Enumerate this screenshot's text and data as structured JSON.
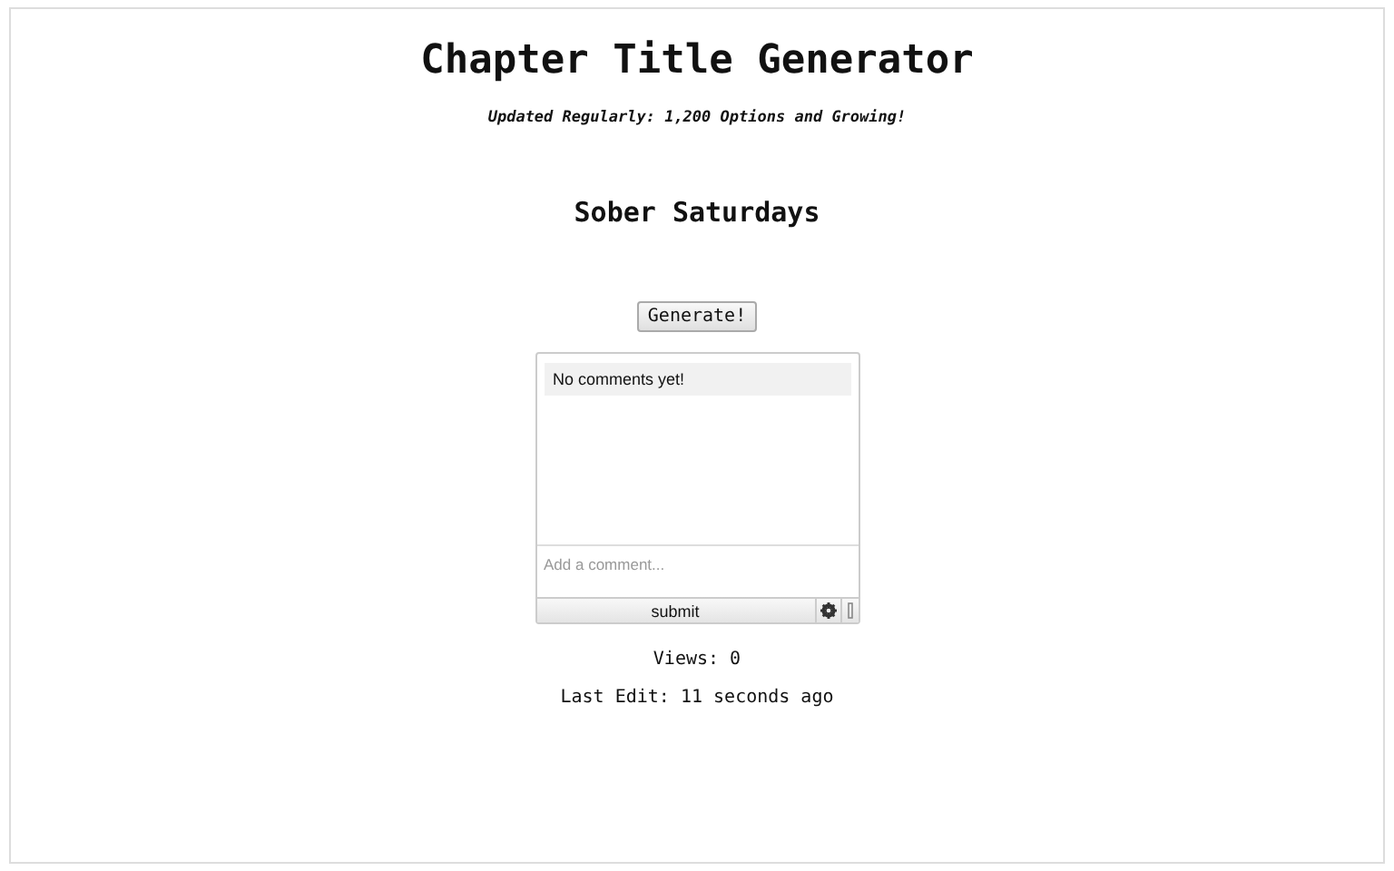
{
  "title": "Chapter Title Generator",
  "subtitle": "Updated Regularly: 1,200 Options and Growing!",
  "result": "Sober Saturdays",
  "generate_button": "Generate!",
  "comments": {
    "empty_message": "No comments yet!",
    "placeholder": "Add a comment...",
    "submit": "submit"
  },
  "views": "Views: 0",
  "last_edit": "Last Edit: 11 seconds ago"
}
